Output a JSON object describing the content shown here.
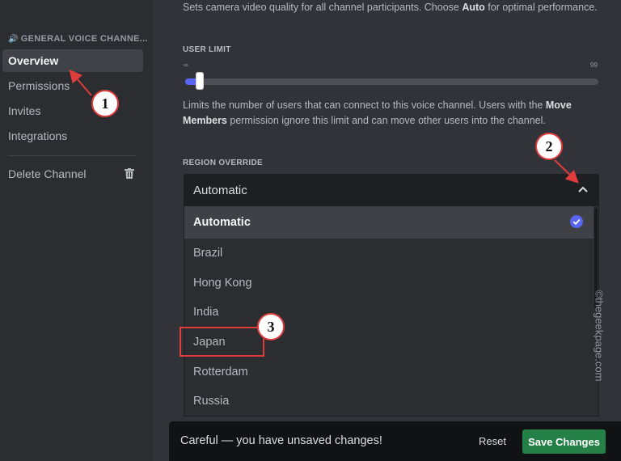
{
  "sidebar": {
    "header": "GENERAL VOICE CHANNE...",
    "items": [
      {
        "label": "Overview",
        "active": true
      },
      {
        "label": "Permissions"
      },
      {
        "label": "Invites"
      },
      {
        "label": "Integrations"
      }
    ],
    "delete_label": "Delete Channel"
  },
  "video_quality": {
    "desc_before": "Sets camera video quality for all channel participants. Choose ",
    "desc_bold": "Auto",
    "desc_after": " for optimal performance."
  },
  "user_limit": {
    "label": "USER LIMIT",
    "min_label": "∞",
    "max_label": "99",
    "value_fraction": 0.03,
    "help_before": "Limits the number of users that can connect to this voice channel. Users with the ",
    "help_bold": "Move Members",
    "help_after": " permission ignore this limit and can move other users into the channel."
  },
  "region_override": {
    "label": "REGION OVERRIDE",
    "selected": "Automatic",
    "options": [
      "Automatic",
      "Brazil",
      "Hong Kong",
      "India",
      "Japan",
      "Rotterdam",
      "Russia"
    ]
  },
  "unsaved": {
    "message": "Careful — you have unsaved changes!",
    "reset_label": "Reset",
    "save_label": "Save Changes"
  },
  "annotations": {
    "callout_1": "1",
    "callout_2": "2",
    "callout_3": "3"
  },
  "watermark": "©thegeekpage.com",
  "colors": {
    "accent": "#5865f2",
    "save": "#248046",
    "annotation": "#e03c3c",
    "check": "#5865f2"
  }
}
